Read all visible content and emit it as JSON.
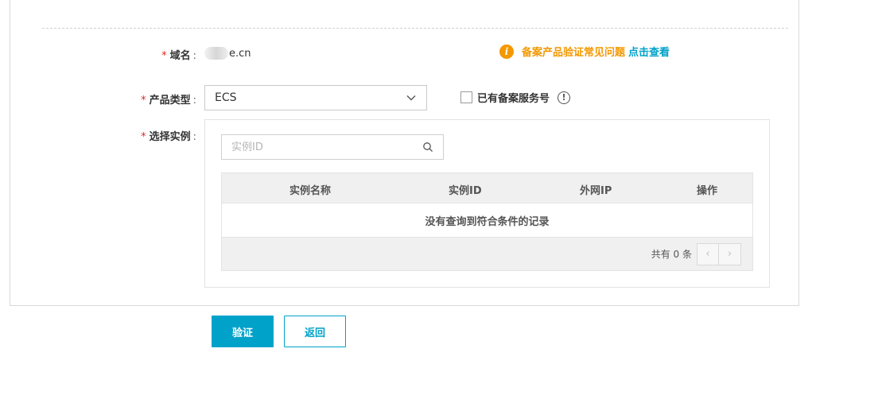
{
  "form": {
    "domain": {
      "required_mark": "*",
      "label": "域名",
      "colon": ":",
      "value_suffix": "e.cn"
    },
    "faq": {
      "icon": "warning-icon",
      "text": "备案产品验证常见问题",
      "link": "点击查看"
    },
    "product_type": {
      "required_mark": "*",
      "label": "产品类型",
      "colon": ":",
      "selected": "ECS"
    },
    "existing_service": {
      "checkbox_label": "已有备案服务号",
      "checked": false,
      "info_icon_text": "!"
    },
    "instance": {
      "required_mark": "*",
      "label": "选择实例",
      "colon": ":",
      "search_placeholder": "实例ID",
      "search_value": ""
    }
  },
  "table": {
    "headers": [
      "实例名称",
      "实例ID",
      "外网IP",
      "操作"
    ],
    "empty_text": "没有查询到符合条件的记录",
    "footer_text": "共有 0 条",
    "prev": "‹",
    "next": "›"
  },
  "actions": {
    "verify_label": "验证",
    "back_label": "返回"
  },
  "colors": {
    "accent": "#00a2ca",
    "warning": "#f39800",
    "required": "#e0281e"
  }
}
